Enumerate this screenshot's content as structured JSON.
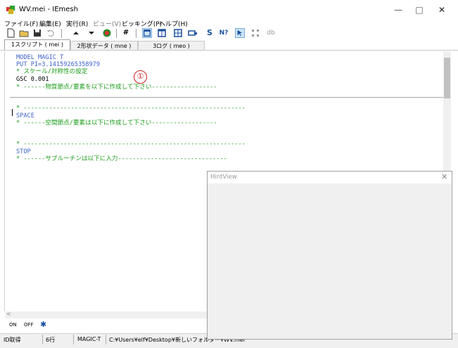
{
  "window": {
    "title": "WV.mei - IEmesh",
    "minimize": "—",
    "maximize": "□",
    "close": "✕"
  },
  "menu": [
    {
      "label": "ファイル(F)"
    },
    {
      "label": "編集(E)"
    },
    {
      "label": "実行(R)"
    },
    {
      "label": "ビュー(V)"
    },
    {
      "label": "ピッキング(P)"
    },
    {
      "label": "ヘルプ(H)"
    }
  ],
  "toolbar": {
    "hash": "#",
    "s": "S",
    "help": "N?",
    "db": "db"
  },
  "tabs": [
    {
      "label": "1スクリプト ( mei )"
    },
    {
      "label": "2形状データ ( mne )"
    },
    {
      "label": "3ログ ( meo )"
    }
  ],
  "editor": {
    "lines": [
      {
        "text": "MODEL MAGIC T",
        "color": "blue"
      },
      {
        "text": "PUT PI=3.14159265358979",
        "color": "blue"
      },
      {
        "text": "* スケール/対称性の設定",
        "color": "green"
      },
      {
        "text": "GSC 0.001",
        "color": "black"
      },
      {
        "text": "* ------物質節点/要素を以下に作成して下さい------------------",
        "color": "green"
      },
      {
        "text": "* -------------------------------------------------------------",
        "color": "green"
      },
      {
        "text": "SPACE",
        "color": "blue"
      },
      {
        "text": "* ------空間節点/要素は以下に作成して下さい------------------",
        "color": "green"
      },
      {
        "text": "* -------------------------------------------------------------",
        "color": "green"
      },
      {
        "text": "STOP",
        "color": "blue"
      },
      {
        "text": "* ------サブルーチンは以下に入力------------------------------",
        "color": "green"
      }
    ],
    "annotation": "①"
  },
  "bottom_tools": {
    "on": "ON",
    "off": "OFF",
    "asterisk": "✱"
  },
  "status": {
    "state": "ID取得",
    "line": "6行",
    "model": "MAGIC-T",
    "path": "C:¥Users¥elf¥Desktop¥新しいフォルダー¥WV.mei"
  },
  "hintview": {
    "title": "HintView",
    "close": "✕"
  },
  "colors": {
    "keyword": "#3a5fcd",
    "comment": "#1a9c1a",
    "annotation": "#d02020"
  }
}
